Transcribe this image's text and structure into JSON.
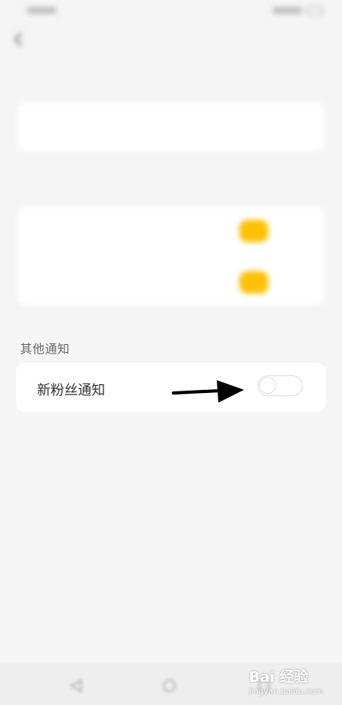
{
  "blurred_header": {
    "status_time": "",
    "title": ""
  },
  "blurred_sections": {
    "section1_label": "",
    "section1_item": "",
    "section2_label": "",
    "section2_items": [
      "",
      ""
    ]
  },
  "other_notifications": {
    "title": "其他通知",
    "items": [
      {
        "label": "新粉丝通知",
        "enabled": false
      }
    ]
  },
  "annotation": {
    "arrow_icon": "arrow-right-icon",
    "arrow_color": "#000000"
  },
  "bottom_nav": {
    "icons": [
      "back-nav-icon",
      "home-nav-icon",
      "recents-nav-icon"
    ]
  },
  "watermark": {
    "brand": "Bai 经验",
    "url": "jingyan.baidu.com"
  },
  "colors": {
    "background": "#f5f5f5",
    "card": "#ffffff",
    "accent_yellow": "#ffc107",
    "toggle_border": "#dcdcdc"
  }
}
